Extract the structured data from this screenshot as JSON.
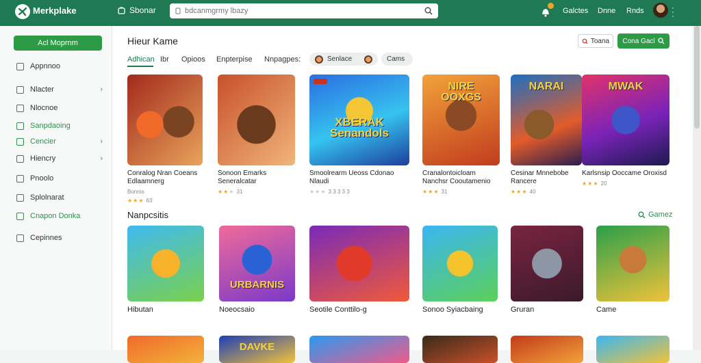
{
  "header": {
    "app_name": "Merkplake",
    "store_label": "Sbonar",
    "search_placeholder": "bdcanmgrmy lbazy",
    "nav": [
      "Galctes",
      "Dnne",
      "Rnds"
    ],
    "notification_count": "",
    "accent": "#1f7a53"
  },
  "sidebar": {
    "primary_button": "Acl Moprnm",
    "items": [
      {
        "label": "Appnnoo",
        "chevron": false,
        "active": false
      },
      {
        "label": "Nlacter",
        "chevron": true,
        "active": false
      },
      {
        "label": "Nlocnoe",
        "chevron": false,
        "active": false
      },
      {
        "label": "Sanpdaoing",
        "chevron": false,
        "active": true
      },
      {
        "label": "Cencier",
        "chevron": true,
        "active": true
      },
      {
        "label": "Hiencry",
        "chevron": true,
        "active": false
      },
      {
        "label": "Pnoolo",
        "chevron": false,
        "active": false
      },
      {
        "label": "Splolnarat",
        "chevron": false,
        "active": false
      },
      {
        "label": "Cnapon Donka",
        "chevron": false,
        "active": true
      },
      {
        "label": "Cepinnes",
        "chevron": false,
        "active": false
      }
    ]
  },
  "main": {
    "title": "Hieur Kame",
    "actions": {
      "outline_label": "Toana",
      "green_label": "Cona Gacl"
    },
    "tabs": [
      "Adhican",
      "Ibr",
      "Opioos",
      "Enpterpise",
      "Nnpagpes:"
    ],
    "chips": [
      "Senlace",
      "Cams"
    ],
    "featured": [
      {
        "title": "Conralog Nran Coeans Edlaamnerg",
        "meta": "Bonrss",
        "rating": "63",
        "stars": 3
      },
      {
        "title": "Sonoon Emarks Seneralcatar",
        "meta": "",
        "rating": "31",
        "stars": 2
      },
      {
        "title": "Smoolrearm Ueoss Cdonao Nlaudi",
        "meta": "",
        "rating": "3 3 3 3 3",
        "stars": 0
      },
      {
        "title": "Cranalontoicloam Nanchsr Cooutamenio",
        "meta": "",
        "rating": "31",
        "stars": 3
      },
      {
        "title": "Cesinar Mnnebobe Rancere",
        "meta": "",
        "rating": "40",
        "stars": 3
      },
      {
        "title": "Karlsnsip Ooccame Oroxisd",
        "meta": "",
        "rating": "20",
        "stars": 3
      }
    ],
    "featured_art": [
      "",
      "",
      "XBERAK Senandols",
      "NIRE OOXGS",
      "NARAI",
      "MWAK"
    ],
    "section_title": "Nanpcsitis",
    "see_more": "Gamez",
    "games": [
      {
        "title": "Hibutan",
        "art": ""
      },
      {
        "title": "Noeocsaio",
        "art": "URBARNIS"
      },
      {
        "title": "Seotile Conttilo-g",
        "art": ""
      },
      {
        "title": "Sonoo Syiacbaing",
        "art": ""
      },
      {
        "title": "Gruran",
        "art": ""
      },
      {
        "title": "Came",
        "art": ""
      }
    ],
    "row3_art": [
      "",
      "DAVKE",
      "",
      "",
      "",
      ""
    ]
  },
  "colors": {
    "accent": "#1f7a53",
    "primary": "#2d9b45",
    "star": "#f0a32a"
  }
}
